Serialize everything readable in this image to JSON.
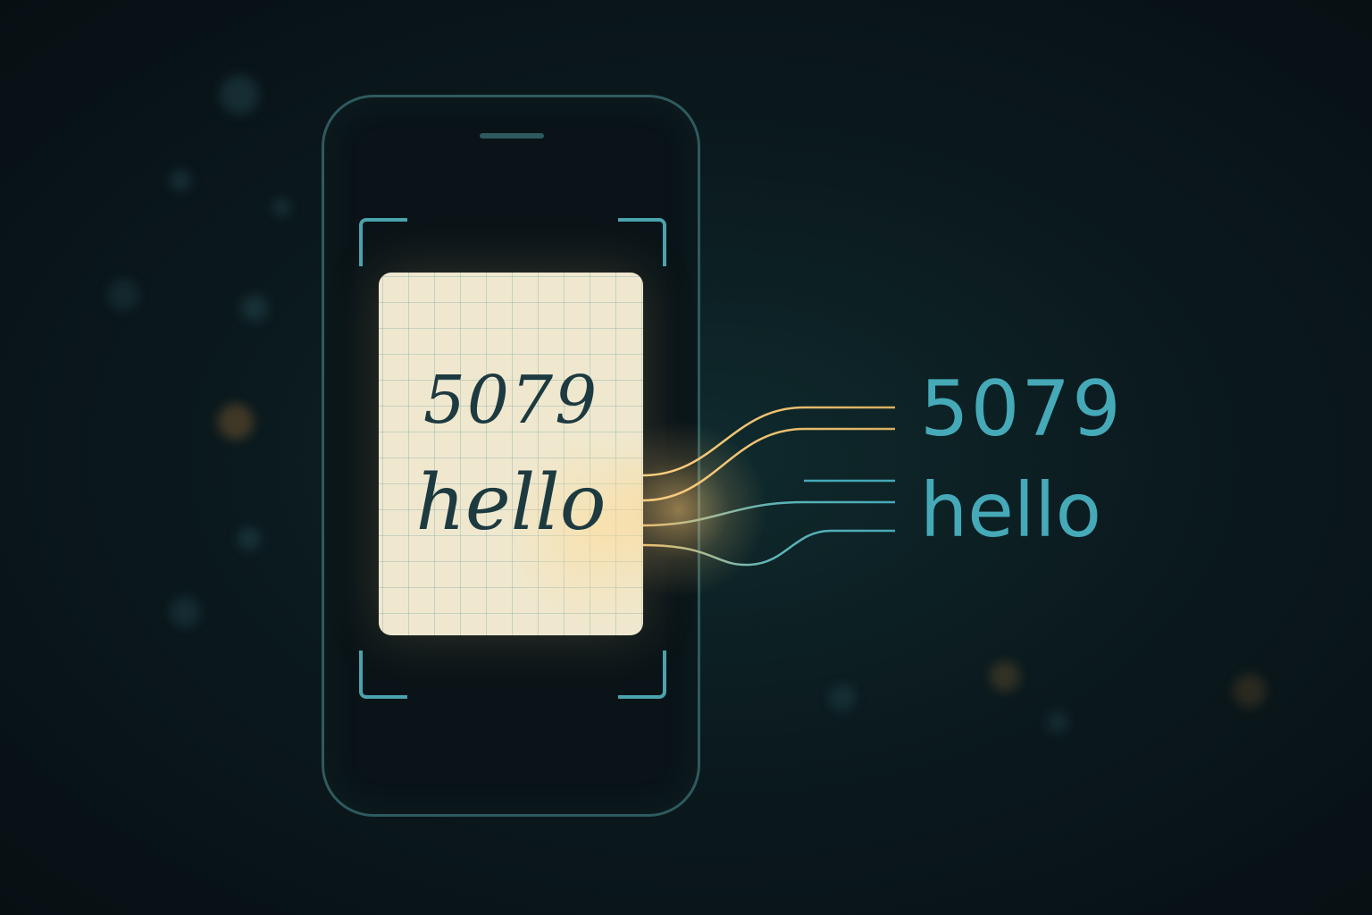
{
  "handwritten": {
    "number": "5079",
    "word": "hello"
  },
  "recognized": {
    "number": "5079",
    "word": "hello"
  },
  "colors": {
    "accent": "#45a9b8",
    "frame": "#2e5a5e",
    "paper": "#efe8cf",
    "ink": "#1d3a40",
    "glow": "#ffcd78"
  }
}
